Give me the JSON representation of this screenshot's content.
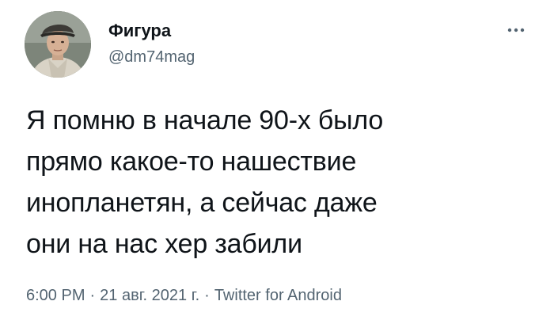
{
  "tweet": {
    "author": {
      "display_name": "Фигура",
      "handle": "@dm74mag"
    },
    "more_icon": "more-horizontal-icon",
    "text": "Я помню в начале 90-х было\nпрямо какое-то нашествие\nинопланетян, а сейчас даже\nони на нас хер забили",
    "meta": {
      "time": "6:00 PM",
      "date": "21 авг. 2021 г.",
      "separator": "·",
      "source": "Twitter for Android"
    },
    "colors": {
      "text": "#0f1419",
      "secondary": "#536471",
      "background": "#ffffff"
    }
  }
}
